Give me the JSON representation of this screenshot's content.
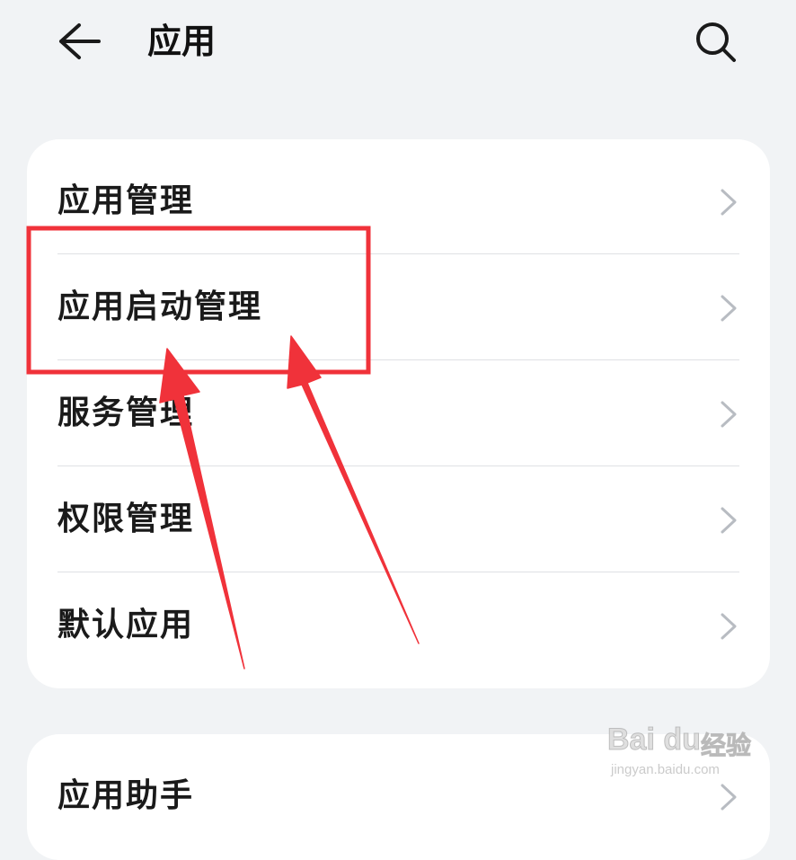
{
  "header": {
    "title": "应用",
    "back_icon": "arrow-left-icon",
    "search_icon": "search-icon"
  },
  "settings_group_1": [
    {
      "label": "应用管理"
    },
    {
      "label": "应用启动管理"
    },
    {
      "label": "服务管理"
    },
    {
      "label": "权限管理"
    },
    {
      "label": "默认应用"
    }
  ],
  "settings_group_2": [
    {
      "label": "应用助手"
    }
  ],
  "annotation": {
    "highlight_color": "#f0323a",
    "highlighted_item": "应用启动管理"
  },
  "watermark": {
    "brand": "Bai du",
    "brand_cn": "经验",
    "url": "jingyan.baidu.com"
  },
  "colors": {
    "background": "#f1f3f5",
    "card": "#ffffff",
    "text": "#1a1a1a",
    "chevron": "#b8bcc2",
    "annotation_red": "#f0323a"
  }
}
